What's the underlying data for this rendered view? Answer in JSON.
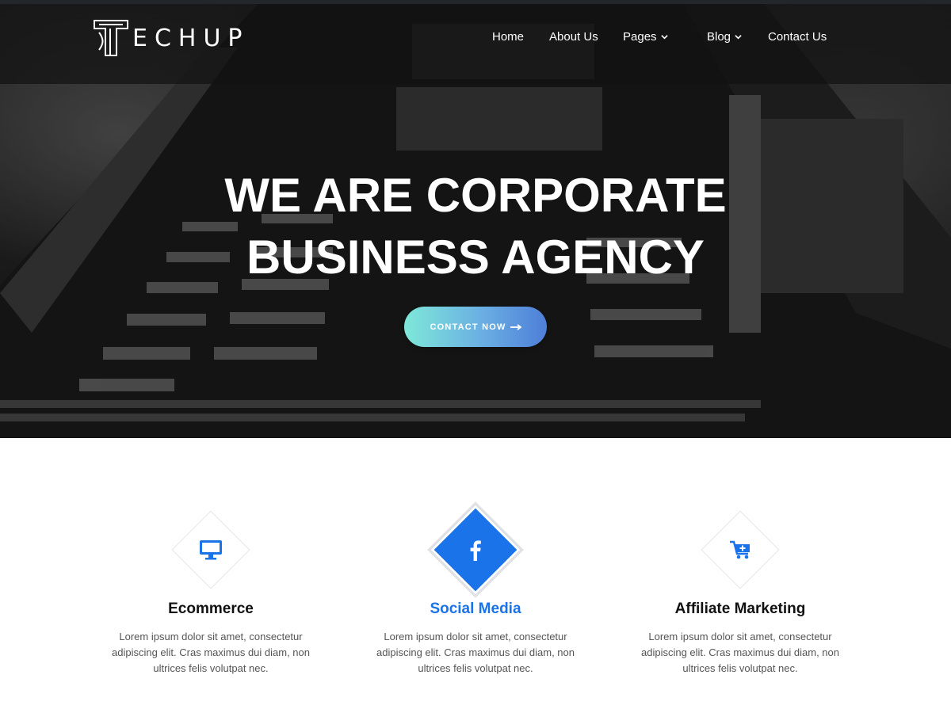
{
  "brand": {
    "logo_text": "ECHUP",
    "accent": "#1a73e8"
  },
  "nav": {
    "items": [
      {
        "label": "Home",
        "has_dropdown": false
      },
      {
        "label": "About Us",
        "has_dropdown": false
      },
      {
        "label": "Pages",
        "has_dropdown": true
      },
      {
        "label": "Blog",
        "has_dropdown": true
      },
      {
        "label": "Contact Us",
        "has_dropdown": false
      }
    ]
  },
  "hero": {
    "title_line1": "WE ARE CORPORATE",
    "title_line2": "BUSINESS AGENCY",
    "cta_label": "CONTACT NOW"
  },
  "features": [
    {
      "icon": "monitor-icon",
      "title": "Ecommerce",
      "text": "Lorem ipsum dolor sit amet, consectetur adipiscing elit. Cras maximus dui diam, non ultrices felis volutpat nec.",
      "active": false
    },
    {
      "icon": "facebook-icon",
      "title": "Social Media",
      "text": "Lorem ipsum dolor sit amet, consectetur adipiscing elit. Cras maximus dui diam, non ultrices felis volutpat nec.",
      "active": true
    },
    {
      "icon": "cart-add-icon",
      "title": "Affiliate Marketing",
      "text": "Lorem ipsum dolor sit amet, consectetur adipiscing elit. Cras maximus dui diam, non ultrices felis volutpat nec.",
      "active": false
    }
  ]
}
